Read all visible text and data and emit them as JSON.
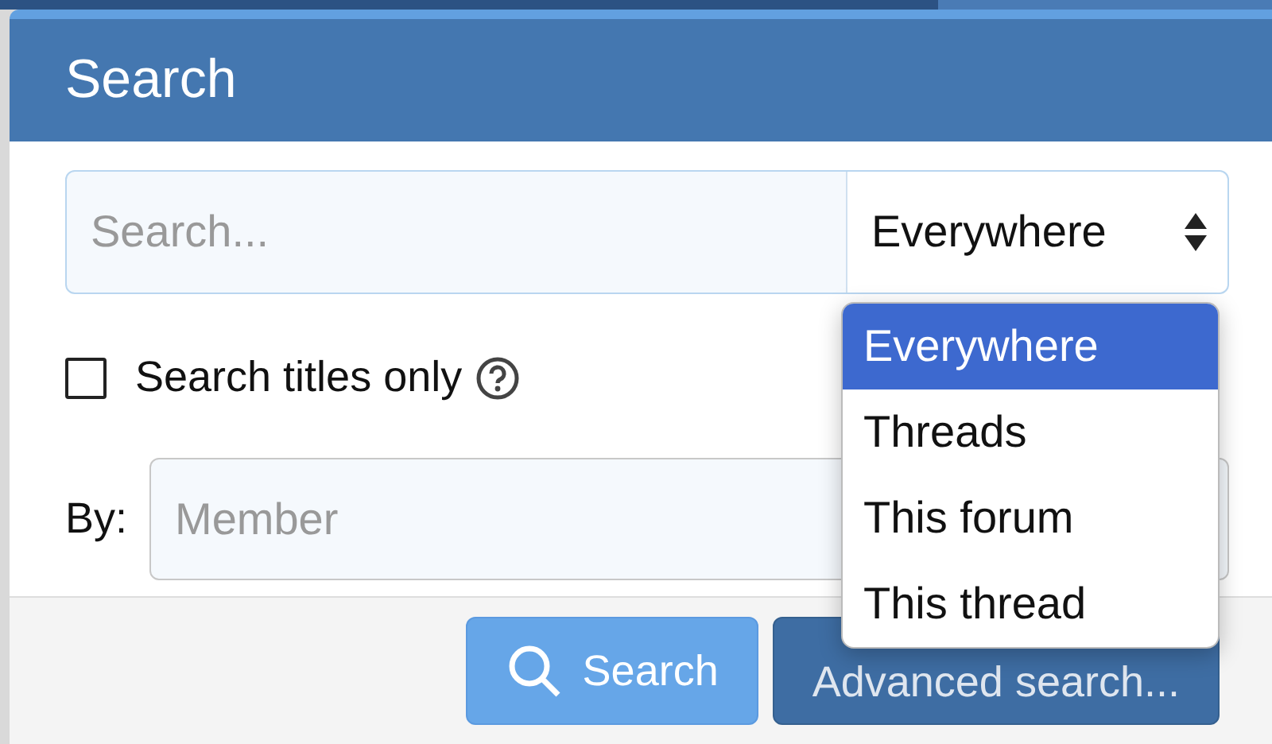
{
  "title": "Search",
  "query": {
    "placeholder": "Search..."
  },
  "scope": {
    "value": "Everywhere",
    "expanded": true,
    "options": [
      {
        "label": "Everywhere",
        "selected": true
      },
      {
        "label": "Threads",
        "selected": false
      },
      {
        "label": "This forum",
        "selected": false
      },
      {
        "label": "This thread",
        "selected": false
      }
    ]
  },
  "titles_only": {
    "label": "Search titles only",
    "checked": false
  },
  "by": {
    "label": "By:",
    "placeholder": "Member"
  },
  "buttons": [
    {
      "label": "Search",
      "kind": "primary"
    },
    {
      "label": "Advanced search...",
      "kind": "secondary"
    }
  ]
}
